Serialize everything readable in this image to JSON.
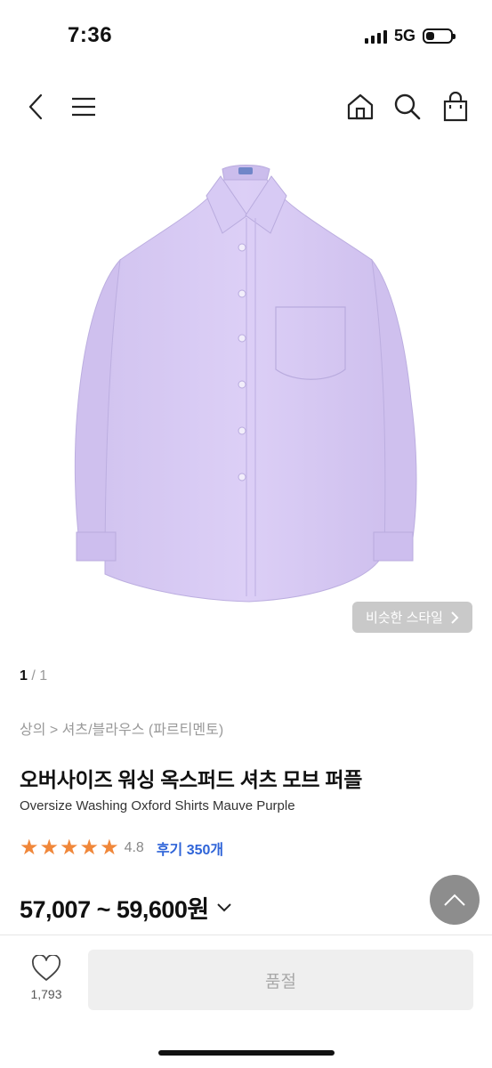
{
  "status_bar": {
    "time": "7:36",
    "network": "5G"
  },
  "nav": {
    "back_icon": "chevron-left-icon",
    "menu_icon": "hamburger-icon",
    "home_icon": "home-icon",
    "search_icon": "search-icon",
    "cart_icon": "shopping-bag-icon"
  },
  "product": {
    "image_color": "#d9ccf3",
    "similar_style_label": "비슷한 스타일",
    "pager_current": "1",
    "pager_total": "/ 1",
    "breadcrumb": "상의 > 셔츠/블라우스 (파르티멘토)",
    "title": "오버사이즈 워싱 옥스퍼드 셔츠 모브 퍼플",
    "subtitle": "Oversize Washing Oxford Shirts Mauve Purple",
    "rating_stars": 4.8,
    "rating_value": "4.8",
    "review_label": "후기 350개",
    "price_range": "57,007 ~ 59,600원"
  },
  "bottom_bar": {
    "like_count": "1,793",
    "soldout_label": "품절"
  },
  "colors": {
    "star": "#f0873a",
    "review_link": "#2f64d8",
    "fab": "#8d8d8d"
  }
}
